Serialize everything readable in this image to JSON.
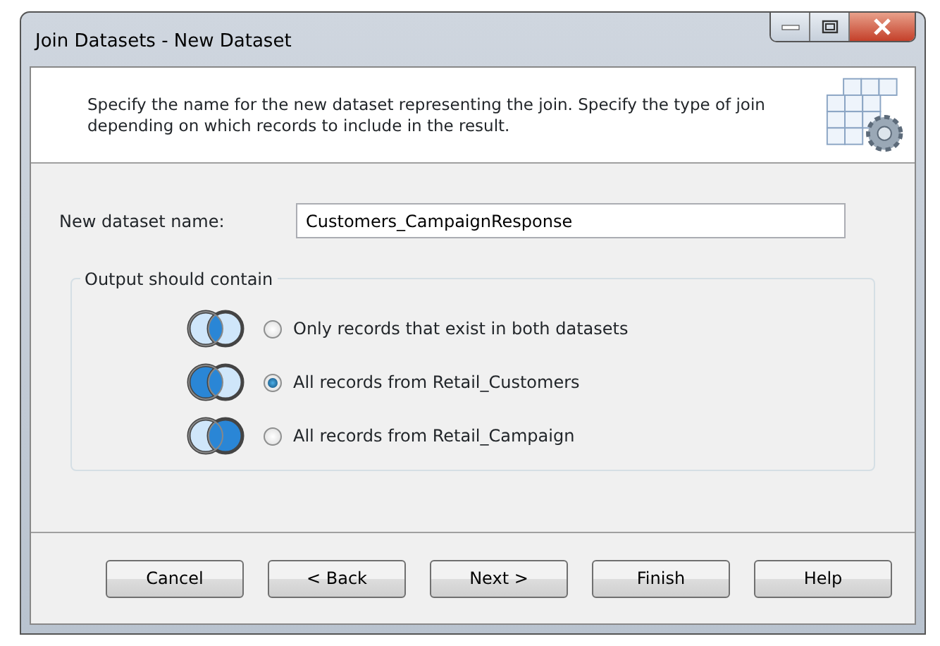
{
  "window": {
    "title": "Join Datasets - New Dataset"
  },
  "header": {
    "description": "Specify the name for the new dataset representing the join. Specify the type of join depending on which records to include in the result."
  },
  "name_field": {
    "label": "New dataset name:",
    "value": "Customers_CampaignResponse"
  },
  "output_group": {
    "title": "Output should contain",
    "options": [
      {
        "kind": "inner",
        "label": "Only records that exist in both datasets",
        "selected": false
      },
      {
        "kind": "left",
        "label": "All records from Retail_Customers",
        "selected": true
      },
      {
        "kind": "right",
        "label": "All records from Retail_Campaign",
        "selected": false
      }
    ]
  },
  "buttons": [
    "Cancel",
    "< Back",
    "Next >",
    "Finish",
    "Help"
  ]
}
